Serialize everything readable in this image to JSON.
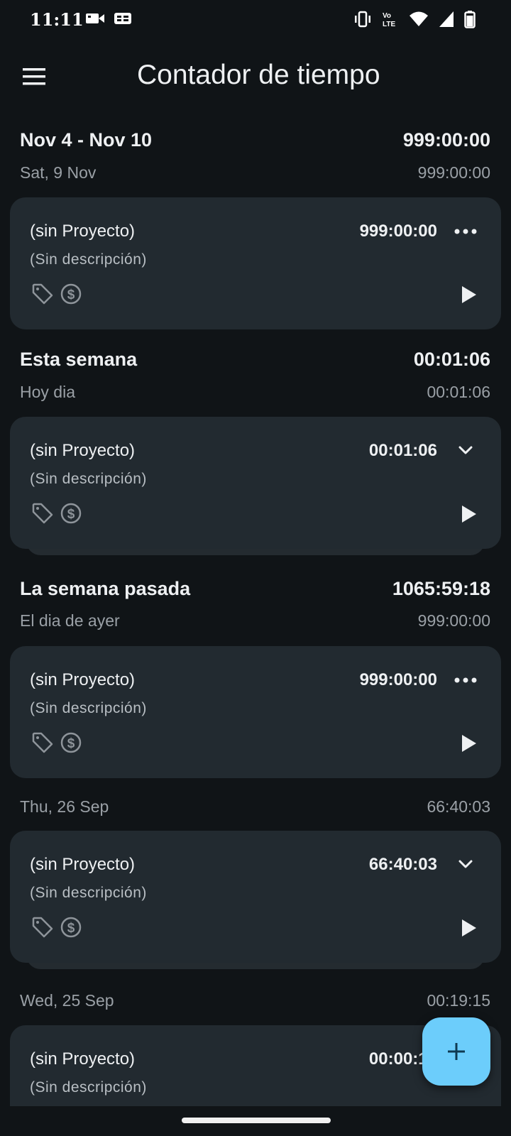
{
  "status_bar": {
    "time": "11:11",
    "left_icons": [
      "video-camera-icon",
      "caption-icon"
    ],
    "right_icons": [
      "vibrate-icon",
      "volte-icon",
      "wifi-icon",
      "signal-icon",
      "battery-icon"
    ],
    "volte_top": "Vo",
    "volte_bottom": "LTE"
  },
  "app_bar": {
    "title": "Contador de tiempo",
    "menu_icon": "menu-icon"
  },
  "sections": [
    {
      "week_label": "Nov 4 - Nov 10",
      "week_total": "999:00:00",
      "days": [
        {
          "day_label": "Sat, 9 Nov",
          "day_total": "999:00:00",
          "entries": [
            {
              "project": "(sin Proyecto)",
              "description": "(Sin descripción)",
              "duration": "999:00:00",
              "action_icon": "more-horizontal-icon",
              "grouped": false
            }
          ]
        }
      ]
    },
    {
      "week_label": "Esta semana",
      "week_total": "00:01:06",
      "days": [
        {
          "day_label": "Hoy dia",
          "day_total": "00:01:06",
          "entries": [
            {
              "project": "(sin Proyecto)",
              "description": "(Sin descripción)",
              "duration": "00:01:06",
              "action_icon": "chevron-down-icon",
              "grouped": true
            }
          ]
        }
      ]
    },
    {
      "week_label": "La semana pasada",
      "week_total": "1065:59:18",
      "days": [
        {
          "day_label": "El dia de ayer",
          "day_total": "999:00:00",
          "entries": [
            {
              "project": "(sin Proyecto)",
              "description": "(Sin descripción)",
              "duration": "999:00:00",
              "action_icon": "more-horizontal-icon",
              "grouped": false
            }
          ]
        },
        {
          "day_label": "Thu, 26 Sep",
          "day_total": "66:40:03",
          "entries": [
            {
              "project": "(sin Proyecto)",
              "description": "(Sin descripción)",
              "duration": "66:40:03",
              "action_icon": "chevron-down-icon",
              "grouped": true
            }
          ]
        },
        {
          "day_label": "Wed, 25 Sep",
          "day_total": "00:19:15",
          "entries": [
            {
              "project": "(sin Proyecto)",
              "description": "(Sin descripción)",
              "duration": "00:00:15",
              "action_icon": "chevron-down-icon",
              "grouped": false
            }
          ]
        }
      ]
    }
  ],
  "fab": {
    "icon": "plus-icon"
  },
  "colors": {
    "background": "#101417",
    "card": "#222a30",
    "accent": "#6ccdfb",
    "secondary_text": "#9aa0a6"
  }
}
